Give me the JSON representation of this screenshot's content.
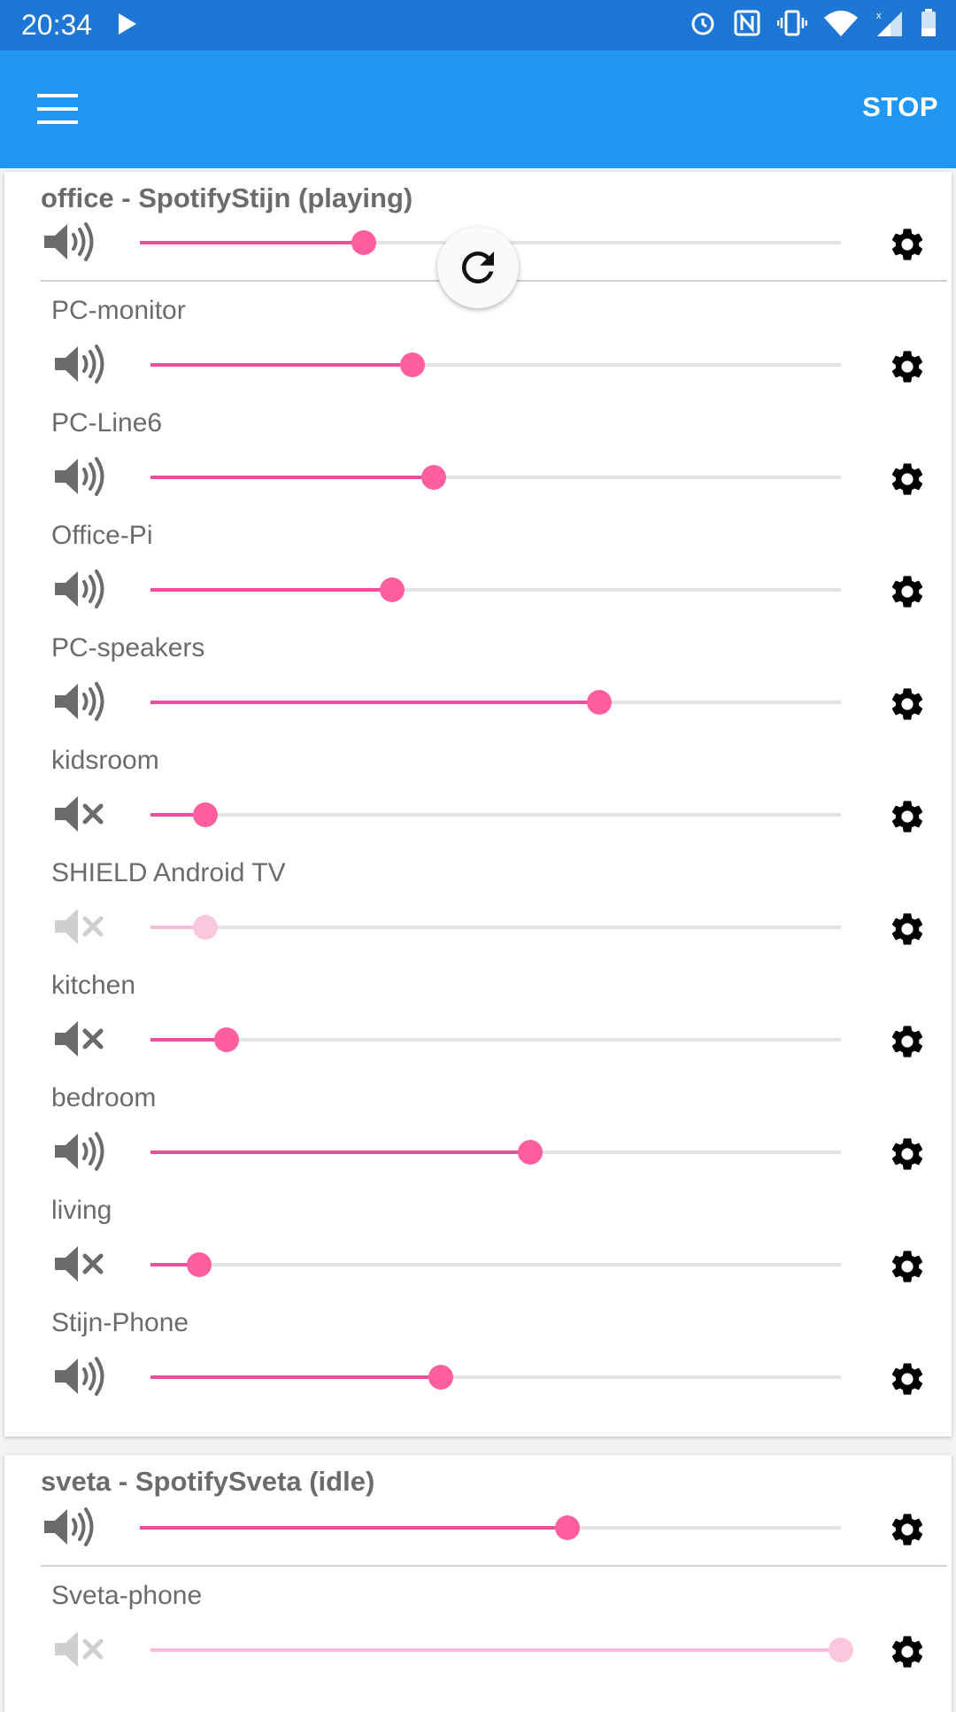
{
  "status_bar": {
    "time": "20:34"
  },
  "app_bar": {
    "stop_label": "STOP"
  },
  "groups": [
    {
      "title": "office - SpotifyStijn (playing)",
      "master_volume": 0.32,
      "master_muted": false,
      "clients": [
        {
          "name": "PC-monitor",
          "volume": 0.38,
          "muted": false,
          "disabled": false
        },
        {
          "name": "PC-Line6",
          "volume": 0.41,
          "muted": false,
          "disabled": false
        },
        {
          "name": "Office-Pi",
          "volume": 0.35,
          "muted": false,
          "disabled": false
        },
        {
          "name": "PC-speakers",
          "volume": 0.65,
          "muted": false,
          "disabled": false
        },
        {
          "name": "kidsroom",
          "volume": 0.08,
          "muted": true,
          "disabled": false
        },
        {
          "name": "SHIELD Android TV",
          "volume": 0.08,
          "muted": true,
          "disabled": true
        },
        {
          "name": "kitchen",
          "volume": 0.11,
          "muted": true,
          "disabled": false
        },
        {
          "name": "bedroom",
          "volume": 0.55,
          "muted": false,
          "disabled": false
        },
        {
          "name": "living",
          "volume": 0.07,
          "muted": true,
          "disabled": false
        },
        {
          "name": "Stijn-Phone",
          "volume": 0.42,
          "muted": false,
          "disabled": false
        }
      ]
    },
    {
      "title": "sveta - SpotifySveta (idle)",
      "master_volume": 0.61,
      "master_muted": false,
      "clients": [
        {
          "name": "Sveta-phone",
          "volume": 1.0,
          "muted": true,
          "disabled": true
        }
      ]
    }
  ],
  "colors": {
    "status_bar": "#1e77d4",
    "app_bar": "#2196f3",
    "slider_fill": "#ec4f9e",
    "slider_thumb": "#ff5f9e",
    "slider_track": "#e3e3e3",
    "text": "#6b6b6b"
  },
  "icons": {
    "menu": "menu-icon",
    "volume": "volume-up-icon",
    "mute": "volume-off-icon",
    "settings": "gear-icon",
    "refresh": "refresh-icon"
  }
}
